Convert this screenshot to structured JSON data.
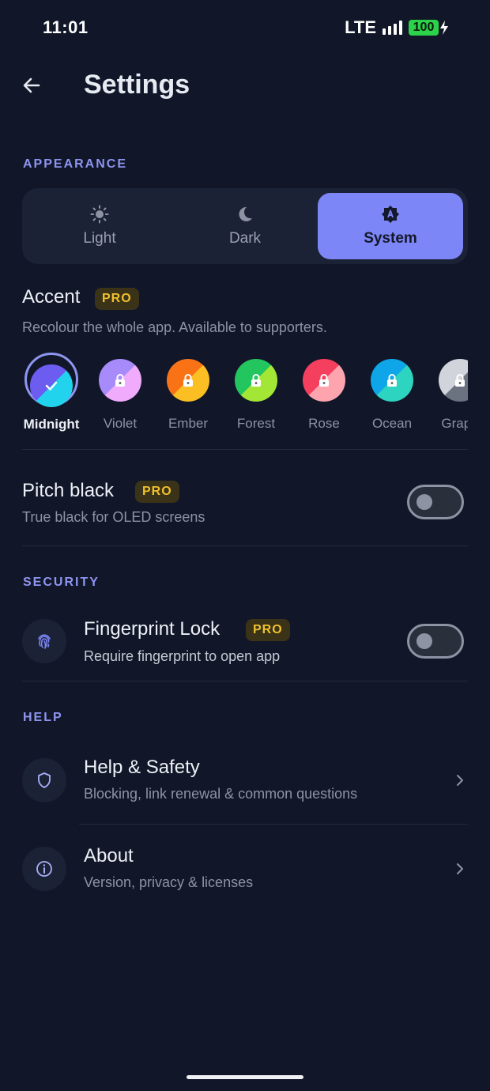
{
  "status": {
    "time": "11:01",
    "network": "LTE",
    "battery": "100"
  },
  "header": {
    "title": "Settings"
  },
  "appearance": {
    "section": "APPEARANCE",
    "themes": [
      {
        "label": "Light",
        "icon": "sun-icon"
      },
      {
        "label": "Dark",
        "icon": "moon-icon"
      },
      {
        "label": "System",
        "icon": "auto-theme-icon",
        "selected": true
      }
    ]
  },
  "accent": {
    "title": "Accent",
    "badge": "PRO",
    "subtitle": "Recolour the whole app. Available to supporters.",
    "swatches": [
      {
        "name": "Midnight",
        "colors": [
          "#6d5cf0",
          "#22d3ee"
        ],
        "selected": true
      },
      {
        "name": "Violet",
        "colors": [
          "#a78bfa",
          "#f0abfc"
        ]
      },
      {
        "name": "Ember",
        "colors": [
          "#f97316",
          "#fbbf24"
        ]
      },
      {
        "name": "Forest",
        "colors": [
          "#22c55e",
          "#a3e635"
        ]
      },
      {
        "name": "Rose",
        "colors": [
          "#f43f5e",
          "#fda4af"
        ]
      },
      {
        "name": "Ocean",
        "colors": [
          "#0ea5e9",
          "#2dd4bf"
        ]
      },
      {
        "name": "Graph",
        "colors": [
          "#d1d5db",
          "#6b7280"
        ]
      }
    ]
  },
  "pitch_black": {
    "title": "Pitch black",
    "badge": "PRO",
    "subtitle": "True black for OLED screens",
    "enabled": false
  },
  "security": {
    "section": "SECURITY",
    "fingerprint": {
      "title": "Fingerprint Lock",
      "badge": "PRO",
      "subtitle": "Require fingerprint to open app",
      "enabled": false
    }
  },
  "help": {
    "section": "HELP",
    "items": [
      {
        "title": "Help & Safety",
        "subtitle": "Blocking, link renewal & common questions",
        "icon": "shield-icon"
      },
      {
        "title": "About",
        "subtitle": "Version, privacy & licenses",
        "icon": "info-icon"
      }
    ]
  },
  "colors": {
    "accent": "#7c86f6",
    "section_label": "#8e95f0",
    "pro": "#f0c02e",
    "background": "#111729"
  }
}
